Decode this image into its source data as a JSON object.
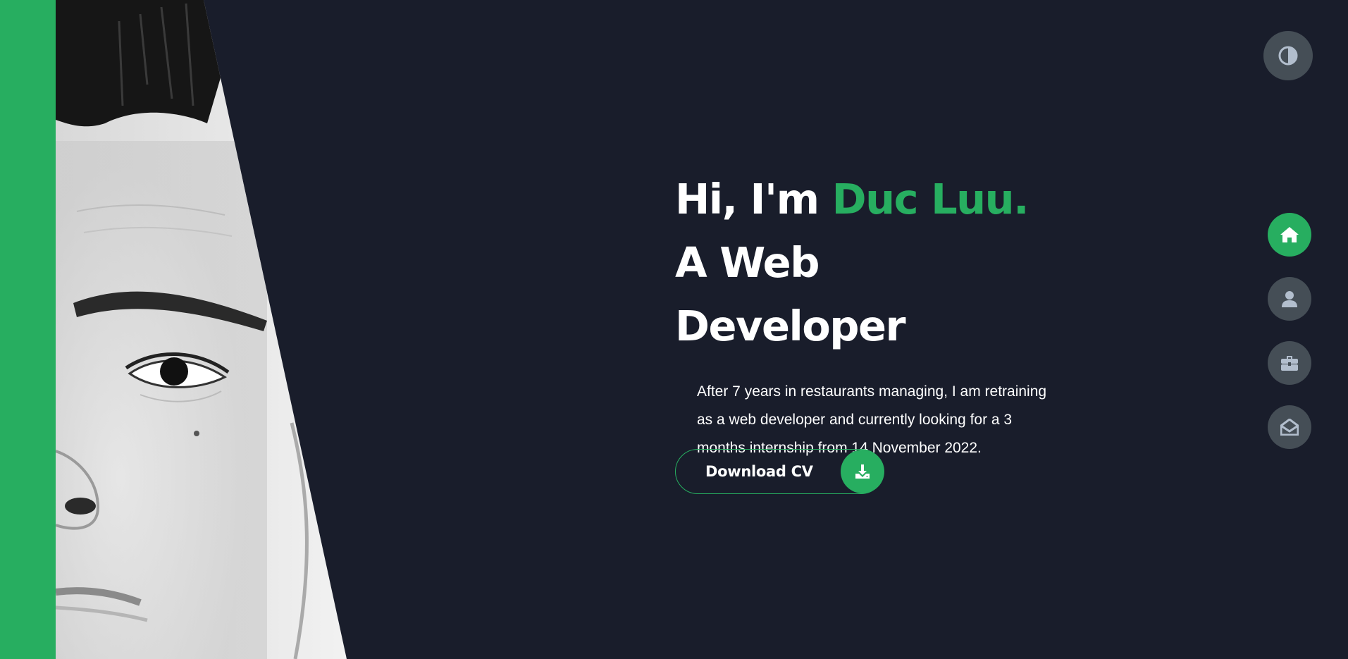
{
  "colors": {
    "background": "#191d2b",
    "accent": "#27ae60",
    "button_gray": "#454e56",
    "text": "#ffffff",
    "icon_gray": "#b2becd"
  },
  "theme_toggle": {
    "icon": "contrast-icon"
  },
  "hero": {
    "title_prefix": "Hi, I'm ",
    "name": "Duc Luu.",
    "title_suffix": " A Web Developer",
    "description": "After 7 years in restaurants managing, I am retraining as a web developer and currently looking for a 3 months internship from 14 November 2022."
  },
  "download": {
    "label": "Download CV",
    "icon": "download-icon"
  },
  "nav": [
    {
      "id": "home",
      "icon": "home-icon",
      "active": true
    },
    {
      "id": "about",
      "icon": "user-icon",
      "active": false
    },
    {
      "id": "portfolio",
      "icon": "briefcase-icon",
      "active": false
    },
    {
      "id": "contact",
      "icon": "envelope-open-icon",
      "active": false
    }
  ]
}
